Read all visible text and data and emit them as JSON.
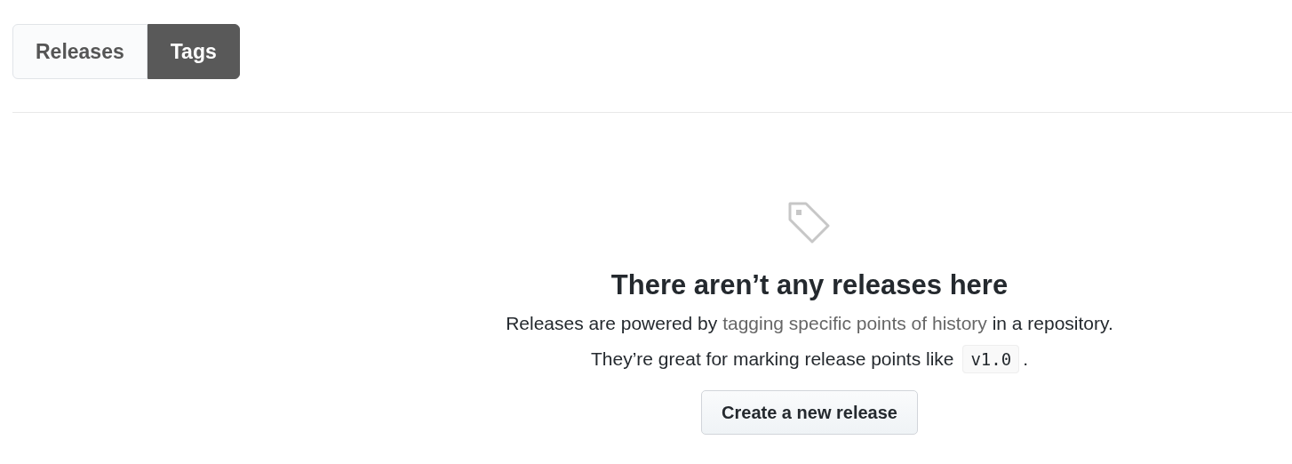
{
  "tabs": [
    {
      "label": "Releases",
      "selected": false
    },
    {
      "label": "Tags",
      "selected": true
    }
  ],
  "blankslate": {
    "title": "There aren’t any releases here",
    "line_1": {
      "before": "Releases are powered by ",
      "link": "tagging specific points of history",
      "after": " in a repository."
    },
    "line_2": {
      "before": "They’re great for marking release points like ",
      "code": "v1.0",
      "after": "."
    },
    "button": "Create a new release"
  }
}
